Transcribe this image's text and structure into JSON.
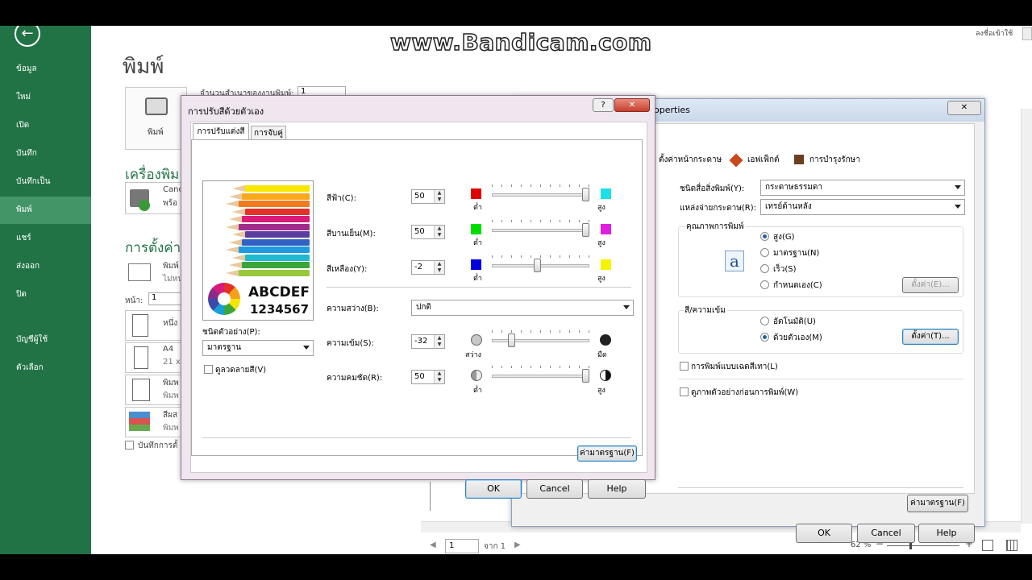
{
  "watermark": "www.Bandicam.com",
  "account": {
    "signin": "ลงชื่อเข้าใช้"
  },
  "sidebar": {
    "items": [
      {
        "label": "ข้อมูล"
      },
      {
        "label": "ใหม่"
      },
      {
        "label": "เปิด"
      },
      {
        "label": "บันทึก"
      },
      {
        "label": "บันทึกเป็น"
      },
      {
        "label": "พิมพ์"
      },
      {
        "label": "แชร์"
      },
      {
        "label": "ส่งออก"
      },
      {
        "label": "ปิด"
      },
      {
        "label": "บัญชีผู้ใช้"
      },
      {
        "label": "ตัวเลือก"
      }
    ]
  },
  "print_pane": {
    "title": "พิมพ์",
    "copies_label": "จำนวนสำเนาของงานพิมพ์:",
    "copies_value": "1",
    "print_button_label": "พิมพ์",
    "printer_heading": "เครื่องพิม",
    "printer_name": "Canc",
    "printer_status": "พร้อ",
    "settings_heading": "การตั้งค่า",
    "setting_print_all": "พิมพ์",
    "setting_print_all_sub": "ไม่หน",
    "pages_label": "หน้า:",
    "pages_value": "1",
    "setting_one_sided": "หนึ่ง",
    "paper_size": "A4",
    "paper_size_sub": "21 x",
    "setting_orientation": "พิมพ",
    "setting_orientation_sub": "พิมพ",
    "setting_color": "สีผส",
    "setting_color_sub": "พิมพ",
    "save_settings_label": "บันทึกการตั้"
  },
  "preview": {
    "page_value": "1",
    "page_of": "จาก 1",
    "zoom": "62 %"
  },
  "properties_dialog": {
    "title": "operties",
    "tabs": [
      {
        "label": "ตั้งค่าหน้ากระดาษ"
      },
      {
        "label": "เอฟเฟ็กต์"
      },
      {
        "label": "การบำรุงรักษา"
      }
    ],
    "media_type_label": "ชนิดสื่อสิ่งพิมพ์(Y):",
    "media_type_value": "กระดาษธรรมดา",
    "paper_source_label": "แหล่งจ่ายกระดาษ(R):",
    "paper_source_value": "เทรย์ด้านหลัง",
    "quality_group": "คุณภาพการพิมพ์",
    "quality_options": [
      {
        "label": "สูง(G)",
        "selected": true
      },
      {
        "label": "มาตรฐาน(N)",
        "selected": false
      },
      {
        "label": "เร็ว(S)",
        "selected": false
      },
      {
        "label": "กำหนดเอง(C)",
        "selected": false
      }
    ],
    "quality_set_button": "ตั้งค่า(E)...",
    "color_group": "สี/ความเข้ม",
    "color_options": [
      {
        "label": "อัตโนมัติ(U)",
        "selected": false
      },
      {
        "label": "ด้วยตัวเอง(M)",
        "selected": true
      }
    ],
    "color_set_button": "ตั้งค่า(T)...",
    "grayscale_label": "การพิมพ์แบบเฉดสีเทา(L)",
    "preview_before_label": "ดูภาพตัวอย่างก่อนการพิมพ์(W)",
    "defaults_button": "ค่ามาตรฐาน(F)",
    "ok": "OK",
    "cancel": "Cancel",
    "help": "Help"
  },
  "color_dialog": {
    "title": "การปรับสีด้วยตัวเอง",
    "help_glyph": "?",
    "close_glyph": "✕",
    "tabs": [
      {
        "label": "การปรับแต่งสี"
      },
      {
        "label": "การจับคู่"
      }
    ],
    "sample_text_1": "ABCDEF",
    "sample_text_2": "1234567",
    "sample_type_label": "ชนิดตัวอย่าง(P):",
    "sample_type_value": "มาตรฐาน",
    "view_pattern_label": "ดูลวดลายสี(V)",
    "sliders": [
      {
        "label": "สีฟ้า(C):",
        "value": "50",
        "low": "ต่ำ",
        "high": "สูง",
        "level": 1.0,
        "left_color": "#e00000",
        "right_color": "#1ee0e8"
      },
      {
        "label": "สีบานเย็น(M):",
        "value": "50",
        "low": "ต่ำ",
        "high": "สูง",
        "level": 1.0,
        "left_color": "#00dd00",
        "right_color": "#e020e0"
      },
      {
        "label": "สีเหลือง(Y):",
        "value": "-2",
        "low": "ต่ำ",
        "high": "สูง",
        "level": 0.48,
        "left_color": "#0000e0",
        "right_color": "#f4f400"
      }
    ],
    "brightness_label": "ความสว่าง(B):",
    "brightness_value": "ปกติ",
    "intensity": {
      "label": "ความเข้ม(S):",
      "value": "-32",
      "low": "สว่าง",
      "high": "มืด",
      "level": 0.2
    },
    "contrast": {
      "label": "ความคมชัด(R):",
      "value": "50",
      "low": "ต่ำ",
      "high": "สูง",
      "level": 1.0
    },
    "defaults_button": "ค่ามาตรฐาน(F)",
    "ok": "OK",
    "cancel": "Cancel",
    "help": "Help"
  }
}
